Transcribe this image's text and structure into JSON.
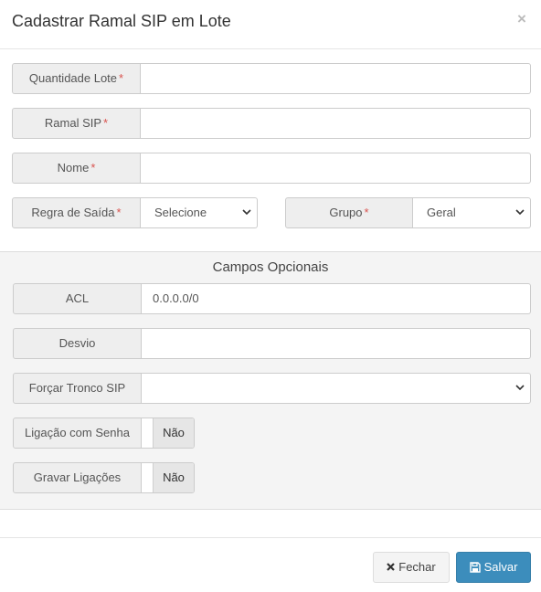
{
  "modal": {
    "title": "Cadastrar Ramal SIP em Lote",
    "close_glyph": "×"
  },
  "fields": {
    "quantidade_lote": {
      "label": "Quantidade Lote",
      "value": ""
    },
    "ramal_sip": {
      "label": "Ramal SIP",
      "value": ""
    },
    "nome": {
      "label": "Nome",
      "value": ""
    },
    "regra_saida": {
      "label": "Regra de Saída",
      "selected": "Selecione"
    },
    "grupo": {
      "label": "Grupo",
      "selected": "Geral"
    },
    "required_marker": "*"
  },
  "optional": {
    "title": "Campos Opcionais",
    "acl": {
      "label": "ACL",
      "value": "0.0.0.0/0"
    },
    "desvio": {
      "label": "Desvio",
      "value": ""
    },
    "forcar_tronco": {
      "label": "Forçar Tronco SIP",
      "selected": ""
    },
    "ligacao_senha": {
      "label": "Ligação com Senha",
      "state": "Não"
    },
    "gravar_ligacoes": {
      "label": "Gravar Ligações",
      "state": "Não"
    }
  },
  "footer": {
    "close_label": "Fechar",
    "save_label": "Salvar",
    "close_icon": "times-icon",
    "save_icon": "floppy-disk-icon",
    "save_color": "#3c8dbc"
  }
}
